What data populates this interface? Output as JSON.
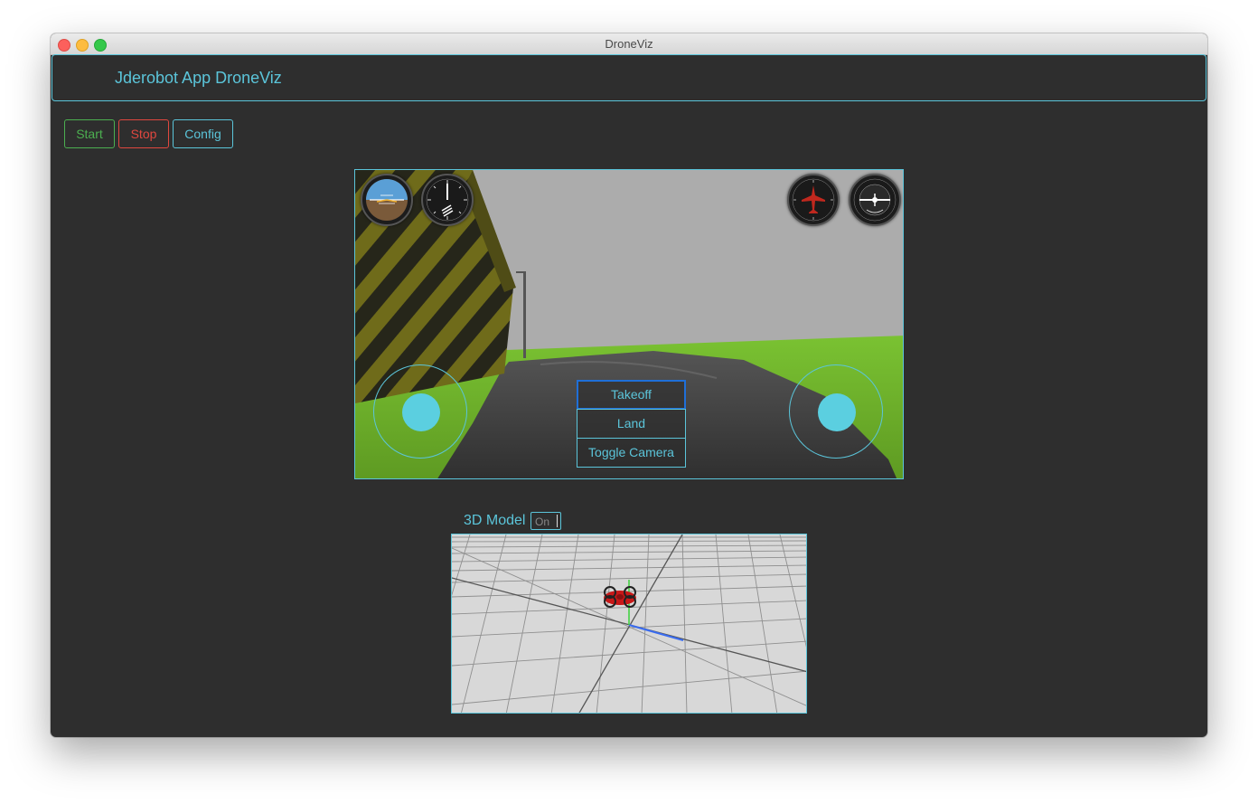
{
  "window": {
    "title": "DroneViz"
  },
  "header": {
    "title": "Jderobot App DroneViz"
  },
  "toolbar": {
    "start_label": "Start",
    "stop_label": "Stop",
    "config_label": "Config"
  },
  "drone_controls": {
    "takeoff_label": "Takeoff",
    "land_label": "Land",
    "toggle_camera_label": "Toggle Camera"
  },
  "instruments": [
    "attitude-indicator-icon",
    "altimeter-icon",
    "turn-coordinator-icon",
    "heading-indicator-icon"
  ],
  "model_3d": {
    "label": "3D Model",
    "toggle_label": "On"
  },
  "colors": {
    "accent": "#5bc5da",
    "start": "#4caf50",
    "stop": "#e0473f",
    "background": "#2e2e2e",
    "active_border": "#1f6fd8"
  }
}
